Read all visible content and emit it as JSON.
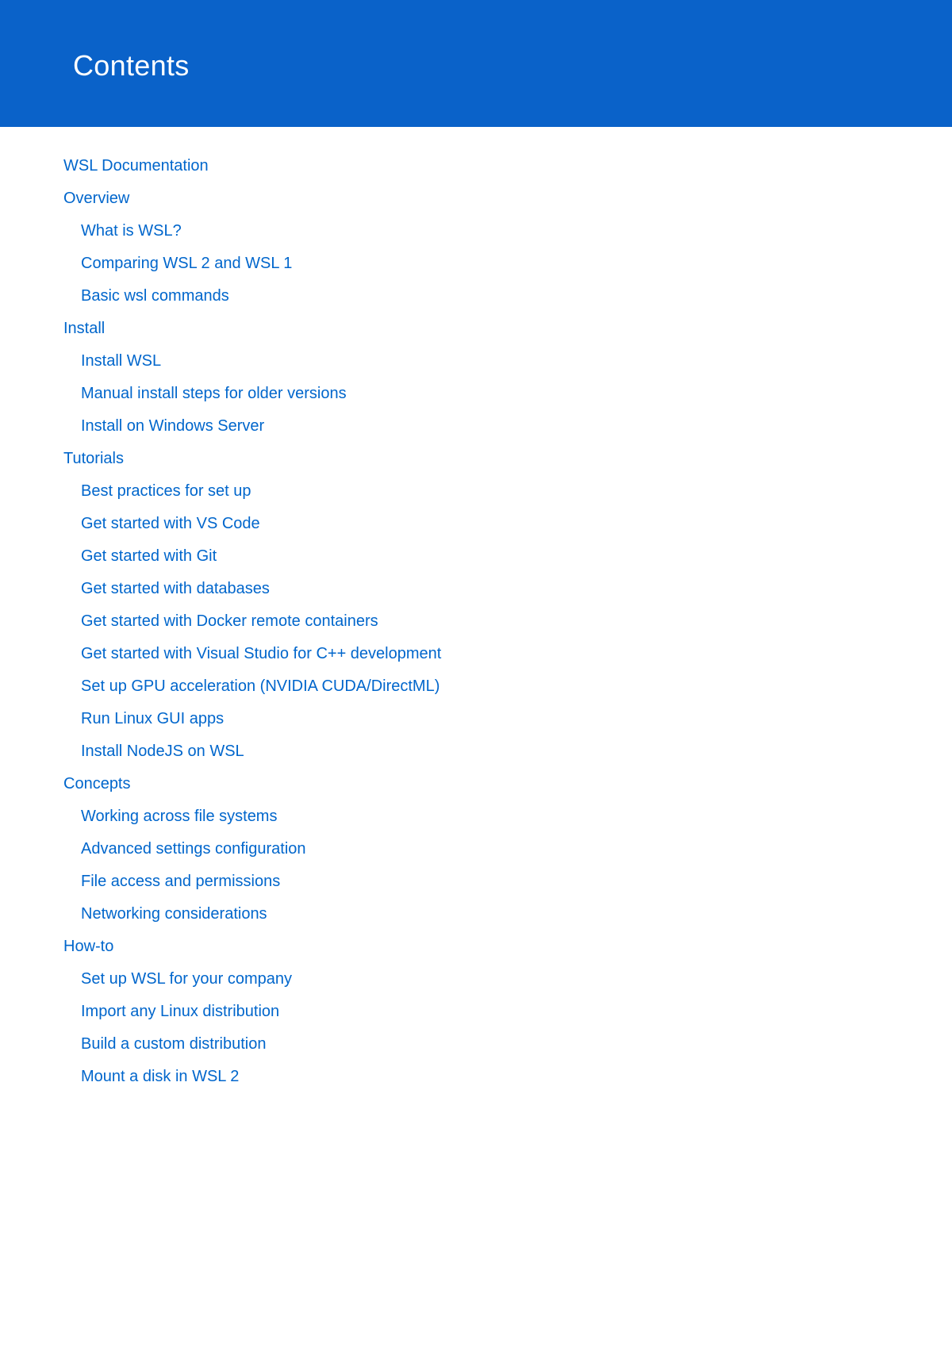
{
  "header": {
    "title": "Contents"
  },
  "toc": [
    {
      "label": "WSL Documentation",
      "level": 0
    },
    {
      "label": "Overview",
      "level": 0
    },
    {
      "label": "What is WSL?",
      "level": 1
    },
    {
      "label": "Comparing WSL 2 and WSL 1",
      "level": 1
    },
    {
      "label": "Basic wsl commands",
      "level": 1
    },
    {
      "label": "Install",
      "level": 0
    },
    {
      "label": "Install WSL",
      "level": 1
    },
    {
      "label": "Manual install steps for older versions",
      "level": 1
    },
    {
      "label": "Install on Windows Server",
      "level": 1
    },
    {
      "label": "Tutorials",
      "level": 0
    },
    {
      "label": "Best practices for set up",
      "level": 1
    },
    {
      "label": "Get started with VS Code",
      "level": 1
    },
    {
      "label": "Get started with Git",
      "level": 1
    },
    {
      "label": "Get started with databases",
      "level": 1
    },
    {
      "label": "Get started with Docker remote containers",
      "level": 1
    },
    {
      "label": "Get started with Visual Studio for C++ development",
      "level": 1
    },
    {
      "label": "Set up GPU acceleration (NVIDIA CUDA/DirectML)",
      "level": 1
    },
    {
      "label": "Run Linux GUI apps",
      "level": 1
    },
    {
      "label": "Install NodeJS on WSL",
      "level": 1
    },
    {
      "label": "Concepts",
      "level": 0
    },
    {
      "label": "Working across file systems",
      "level": 1
    },
    {
      "label": "Advanced settings configuration",
      "level": 1
    },
    {
      "label": "File access and permissions",
      "level": 1
    },
    {
      "label": "Networking considerations",
      "level": 1
    },
    {
      "label": "How-to",
      "level": 0
    },
    {
      "label": "Set up WSL for your company",
      "level": 1
    },
    {
      "label": "Import any Linux distribution",
      "level": 1
    },
    {
      "label": "Build a custom distribution",
      "level": 1
    },
    {
      "label": "Mount a disk in WSL 2",
      "level": 1
    }
  ]
}
